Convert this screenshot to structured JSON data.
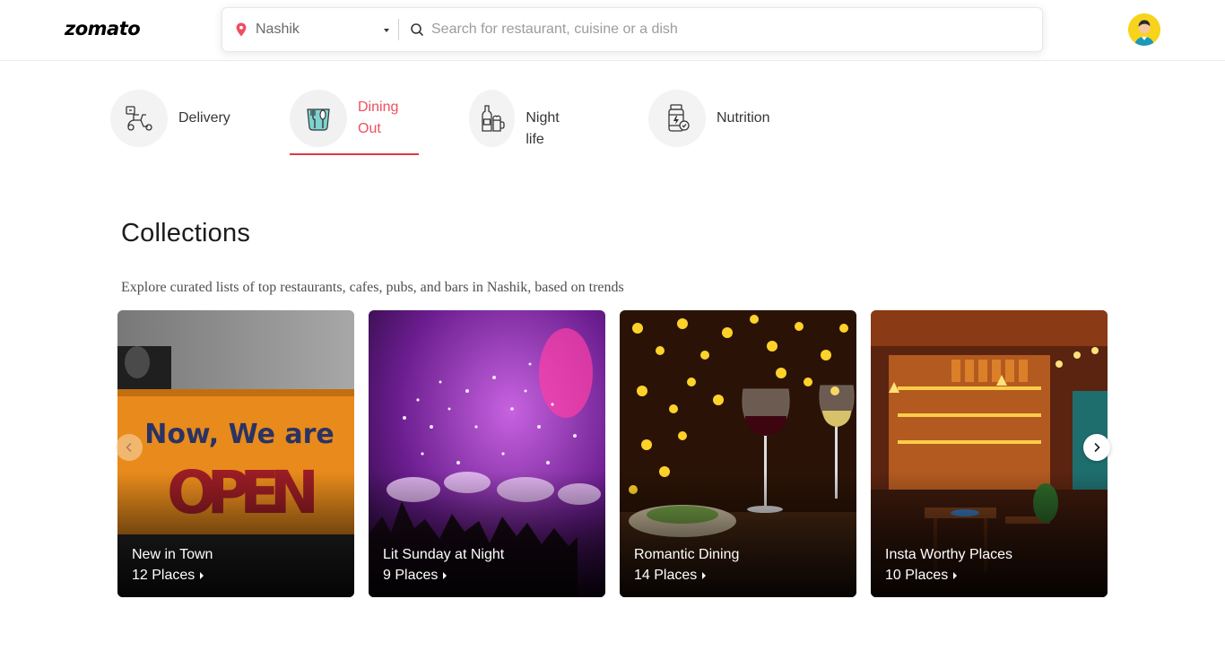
{
  "header": {
    "logo": "zomato",
    "location": "Nashik",
    "search_placeholder": "Search for restaurant, cuisine or a dish"
  },
  "tabs": [
    {
      "label": "Delivery",
      "icon": "scooter-icon",
      "active": false
    },
    {
      "label": "Dining Out",
      "icon": "dining-icon",
      "active": true
    },
    {
      "label": "Night life",
      "icon": "drinks-icon",
      "active": false
    },
    {
      "label": "Nutrition",
      "icon": "supplement-jar-icon",
      "active": false
    }
  ],
  "collections": {
    "title": "Collections",
    "subtitle": "Explore curated lists of top restaurants, cafes, pubs, and bars in Nashik, based on trends",
    "cards": [
      {
        "title": "New in Town",
        "count": "12 Places"
      },
      {
        "title": "Lit Sunday at Night",
        "count": "9 Places"
      },
      {
        "title": "Romantic Dining",
        "count": "14 Places"
      },
      {
        "title": "Insta Worthy Places",
        "count": "10 Places"
      }
    ]
  },
  "colors": {
    "brand_red": "#e23744",
    "active_tab_text": "#ef4f5f",
    "avatar_bg": "#f7d31c"
  }
}
